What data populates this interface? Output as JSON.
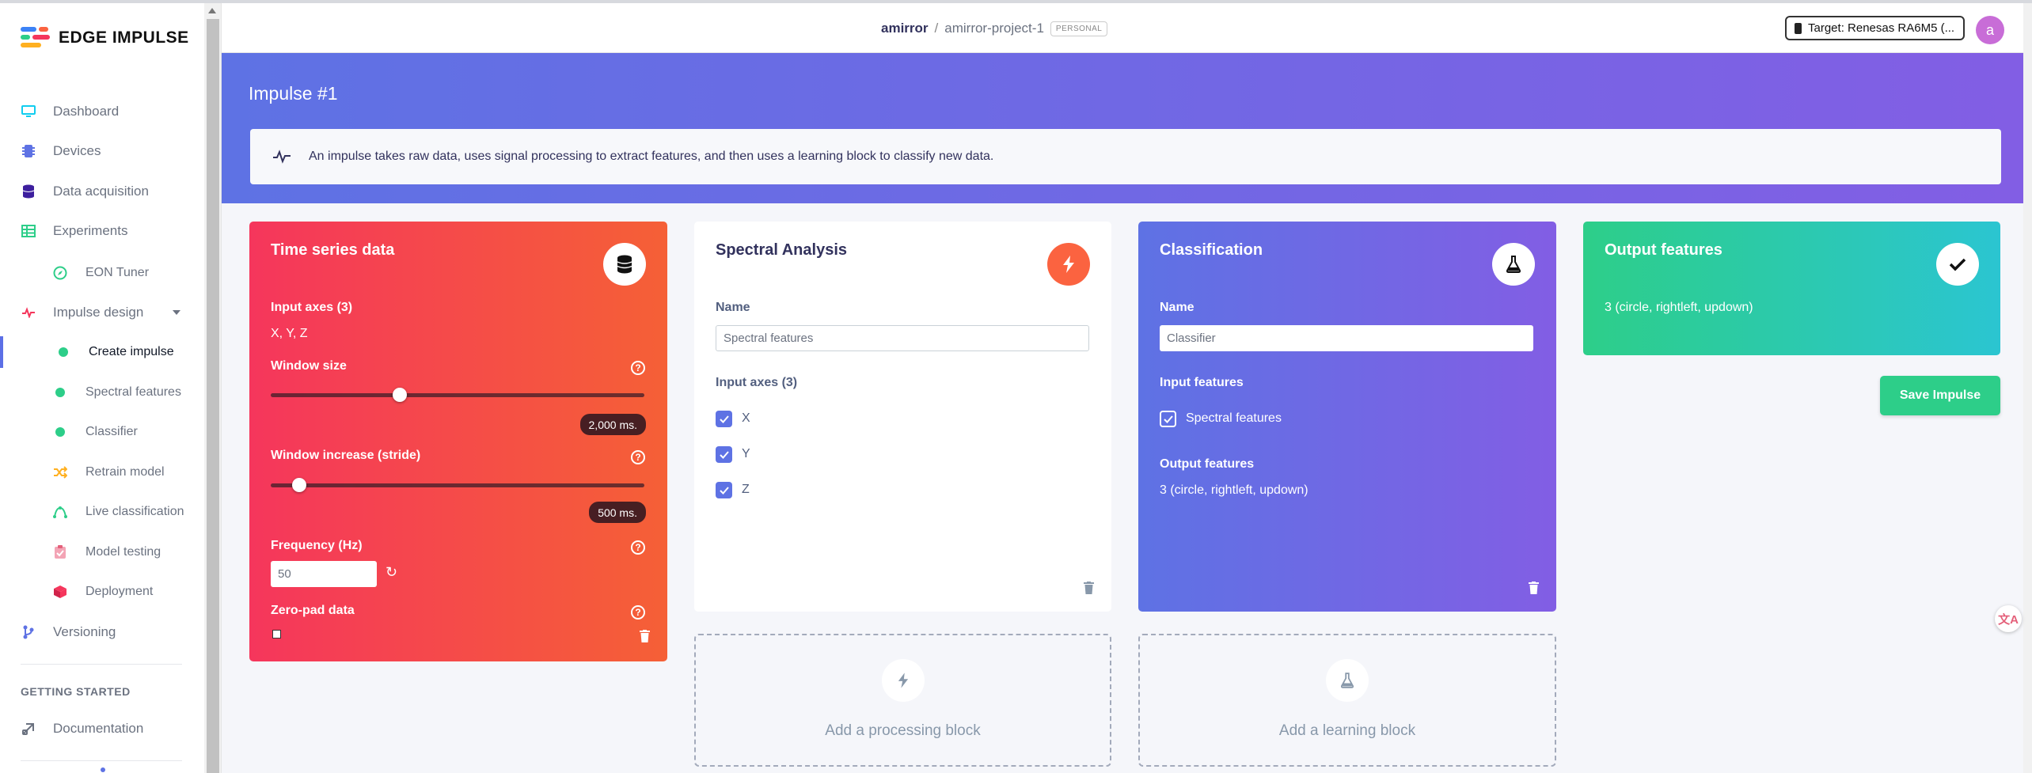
{
  "app": {
    "logo_text": "EDGE IMPULSE"
  },
  "sidebar": {
    "items": [
      {
        "label": "Dashboard",
        "icon": "monitor-icon"
      },
      {
        "label": "Devices",
        "icon": "chip-icon"
      },
      {
        "label": "Data acquisition",
        "icon": "database-icon"
      },
      {
        "label": "Experiments",
        "icon": "table-icon"
      },
      {
        "label": "EON Tuner",
        "icon": "compass-icon"
      },
      {
        "label": "Impulse design",
        "icon": "pulse-icon"
      },
      {
        "label": "Create impulse",
        "icon": "dot-icon"
      },
      {
        "label": "Spectral features",
        "icon": "dot-icon"
      },
      {
        "label": "Classifier",
        "icon": "dot-icon"
      },
      {
        "label": "Retrain model",
        "icon": "shuffle-icon"
      },
      {
        "label": "Live classification",
        "icon": "live-icon"
      },
      {
        "label": "Model testing",
        "icon": "clipboard-check-icon"
      },
      {
        "label": "Deployment",
        "icon": "cube-icon"
      },
      {
        "label": "Versioning",
        "icon": "git-branch-icon"
      }
    ],
    "section_getting_started": "GETTING STARTED",
    "documentation": "Documentation"
  },
  "header": {
    "user": "amirror",
    "separator": "/",
    "project": "amirror-project-1",
    "badge": "PERSONAL",
    "target": "Target: Renesas RA6M5 (...",
    "avatar_letter": "a"
  },
  "banner": {
    "title": "Impulse #1",
    "info": "An impulse takes raw data, uses signal processing to extract features, and then uses a learning block to classify new data."
  },
  "time_series": {
    "title": "Time series data",
    "input_axes_label": "Input axes (3)",
    "input_axes_value": "X, Y, Z",
    "window_size_label": "Window size",
    "window_size_value": "2,000 ms.",
    "window_size_level": 0.34,
    "stride_label": "Window increase (stride)",
    "stride_value": "500 ms.",
    "stride_level": 0.06,
    "frequency_label": "Frequency (Hz)",
    "frequency_value": "50",
    "zero_pad_label": "Zero-pad data"
  },
  "spectral": {
    "title": "Spectral Analysis",
    "name_label": "Name",
    "name_value": "Spectral features",
    "input_axes_label": "Input axes (3)",
    "axes": [
      "X",
      "Y",
      "Z"
    ]
  },
  "classification": {
    "title": "Classification",
    "name_label": "Name",
    "name_value": "Classifier",
    "input_features_label": "Input features",
    "input_feature": "Spectral features",
    "output_features_label": "Output features",
    "output_features_value": "3 (circle, rightleft, updown)"
  },
  "output": {
    "title": "Output features",
    "value": "3 (circle, rightleft, updown)"
  },
  "actions": {
    "save_impulse": "Save Impulse",
    "add_processing": "Add a processing block",
    "add_learning": "Add a learning block"
  },
  "colors": {
    "accent": "#5e72e4",
    "purple": "#825ee4",
    "green": "#2dce89",
    "teal": "#2bc5d1",
    "red": "#f5365c",
    "orange": "#fb6340"
  }
}
